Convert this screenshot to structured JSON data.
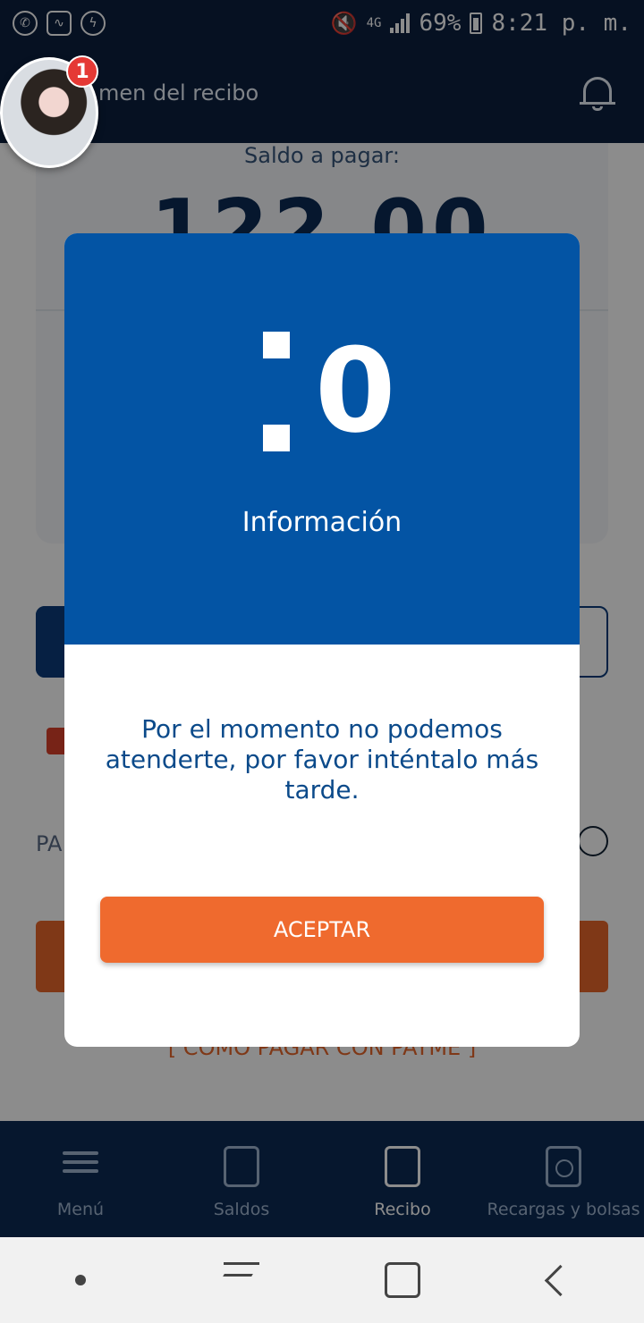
{
  "status_bar": {
    "battery": "69%",
    "time": "8:21 p. m.",
    "network": "4G"
  },
  "header": {
    "title": "men del recibo",
    "notification_count": "1"
  },
  "main": {
    "saldo_label": "Saldo a pagar:",
    "amount": "122.00",
    "pay_label": "PA",
    "como_link": "[ COMO PAGAR CON PAYME ]"
  },
  "dialog": {
    "icon": ":0",
    "title": "Información",
    "message": "Por el momento no podemos atenderte, por favor inténtalo más tarde.",
    "accept_label": "ACEPTAR"
  },
  "tabs": [
    {
      "label": "Menú"
    },
    {
      "label": "Saldos"
    },
    {
      "label": "Recibo"
    },
    {
      "label": "Recargas y bolsas"
    }
  ],
  "colors": {
    "dialog_header": "#0354a4",
    "accent_orange": "#ef6a2e",
    "app_navy": "#0b1f3f"
  }
}
